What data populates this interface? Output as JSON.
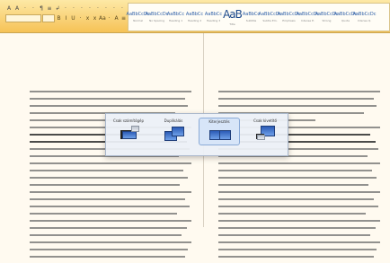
{
  "ribbon": {
    "quick_access": [
      "A",
      "A",
      "·",
      "·",
      "¶",
      "≡",
      "↲",
      "·",
      "·",
      "·",
      "·",
      "·",
      "·",
      "·",
      "·"
    ],
    "format_row": [
      "B",
      "I",
      "U",
      "·",
      "x",
      "x",
      "Aa",
      "·",
      "A",
      "≡",
      "≡",
      "≡",
      "≡",
      "·",
      "·",
      "·"
    ],
    "styles": [
      {
        "sample": "AaBbCcDc",
        "name": "Normal"
      },
      {
        "sample": "AaBbCcDc",
        "name": "No Spacing"
      },
      {
        "sample": "AaBbCc",
        "name": "Heading 1"
      },
      {
        "sample": "AaBbCc",
        "name": "Heading 2"
      },
      {
        "sample": "AaBbCc",
        "name": "Heading 3"
      },
      {
        "sample": "AaB",
        "name": "Title"
      },
      {
        "sample": "AaBbCc",
        "name": "Subtitle"
      },
      {
        "sample": "AaBbCcDc",
        "name": "Subtle Em."
      },
      {
        "sample": "AaBbCcDc",
        "name": "Emphasis"
      },
      {
        "sample": "AaBbCcDc",
        "name": "Intense E."
      },
      {
        "sample": "AaBbCcDc",
        "name": "Strong"
      },
      {
        "sample": "AaBbCcDc",
        "name": "Quote"
      },
      {
        "sample": "AaBbCcDc",
        "name": "Intense Q."
      }
    ]
  },
  "display_switcher": {
    "options": [
      {
        "label": "Csak számítógép",
        "icon": "pc-only-icon"
      },
      {
        "label": "Duplikálás",
        "icon": "duplicate-icon"
      },
      {
        "label": "Kiterjesztés",
        "icon": "extend-icon"
      },
      {
        "label": "Csak kivetítő",
        "icon": "projector-only-icon"
      }
    ],
    "selected_index": 2
  },
  "document": {
    "left_column_lines": 24,
    "right_column_lines": 24
  }
}
